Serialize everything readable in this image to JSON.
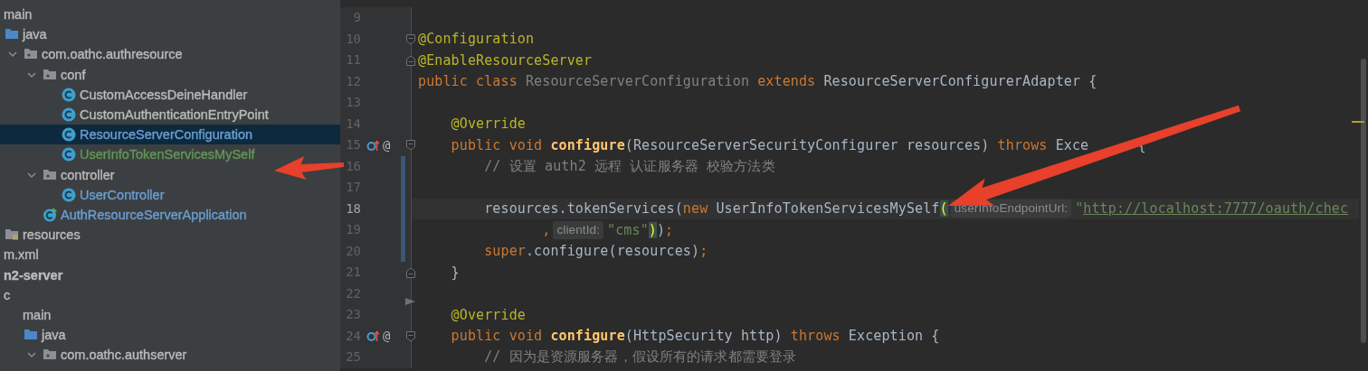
{
  "project_tree": {
    "items": [
      {
        "label": "main",
        "kind": "dir",
        "color": "#bbbbbb",
        "selected": false,
        "children": [
          {
            "label": "java",
            "kind": "source-folder",
            "color": "#bbbbbb",
            "selected": false,
            "children": [
              {
                "label": "com.oathc.authresource",
                "kind": "package",
                "color": "#bbbbbb",
                "selected": false,
                "expanded": true,
                "children": [
                  {
                    "label": "conf",
                    "kind": "package",
                    "color": "#bbbbbb",
                    "selected": false,
                    "expanded": true,
                    "children": [
                      {
                        "label": "CustomAccessDeineHandler",
                        "kind": "class",
                        "color": "#bbbbbb",
                        "selected": false
                      },
                      {
                        "label": "CustomAuthenticationEntryPoint",
                        "kind": "class",
                        "color": "#bbbbbb",
                        "selected": false
                      },
                      {
                        "label": "ResourceServerConfiguration",
                        "kind": "class",
                        "color": "#6a9fd4",
                        "selected": true
                      },
                      {
                        "label": "UserInfoTokenServicesMySelf",
                        "kind": "class",
                        "color": "#629755",
                        "selected": false
                      }
                    ]
                  },
                  {
                    "label": "controller",
                    "kind": "package",
                    "color": "#bbbbbb",
                    "selected": false,
                    "expanded": true,
                    "children": [
                      {
                        "label": "UserController",
                        "kind": "class",
                        "color": "#6a9fd4",
                        "selected": false
                      }
                    ]
                  },
                  {
                    "label": "AuthResourceServerApplication",
                    "kind": "app-class",
                    "color": "#6a9fd4",
                    "selected": false
                  }
                ]
              }
            ]
          },
          {
            "label": "resources",
            "kind": "resources-folder",
            "color": "#bbbbbb",
            "selected": false
          }
        ]
      },
      {
        "label": "m.xml",
        "kind": "file",
        "color": "#bbbbbb",
        "selected": false
      },
      {
        "label": "n2-server",
        "kind": "module",
        "color": "#bbbbbb",
        "selected": false
      },
      {
        "label": "c",
        "kind": "dir",
        "color": "#bbbbbb",
        "selected": false,
        "children": [
          {
            "label": "main",
            "kind": "dir",
            "color": "#bbbbbb",
            "selected": false,
            "children": [
              {
                "label": "java",
                "kind": "source-folder",
                "color": "#bbbbbb",
                "selected": false,
                "children": [
                  {
                    "label": "com.oathc.authserver",
                    "kind": "package",
                    "color": "#bbbbbb",
                    "selected": false,
                    "expanded": true
                  }
                ]
              }
            ]
          }
        ]
      }
    ]
  },
  "editor": {
    "lines": [
      {
        "number": "9"
      },
      {
        "number": "10",
        "fold": {
          "kind": "start"
        },
        "tokens": [
          {
            "kind": "annotation",
            "text": "@Configuration"
          }
        ]
      },
      {
        "number": "11",
        "fold": {
          "kind": "end"
        },
        "tokens": [
          {
            "kind": "annotation",
            "text": "@EnableResourceServer"
          }
        ]
      },
      {
        "number": "12",
        "tokens": [
          {
            "kind": "keyword",
            "text": "public class "
          },
          {
            "kind": "unused",
            "text": "ResourceServerConfiguration"
          },
          {
            "kind": "keyword",
            "text": " extends "
          },
          {
            "kind": "plain",
            "text": "ResourceServerConfigurerAdapter {"
          }
        ]
      },
      {
        "number": "13"
      },
      {
        "number": "14",
        "tokens": [
          {
            "kind": "annotation",
            "text": "    @Override"
          }
        ]
      },
      {
        "number": "15",
        "override": true,
        "gutter_symbol": "@",
        "fold": {
          "kind": "start"
        },
        "tokens": [
          {
            "kind": "keyword",
            "text": "    public void "
          },
          {
            "kind": "method",
            "text": "configure"
          },
          {
            "kind": "plain",
            "text": "(ResourceServerSecurityConfigurer resources) "
          },
          {
            "kind": "keyword",
            "text": "throws"
          },
          {
            "kind": "plain",
            "text": " Exce"
          },
          {
            "kind": "plain",
            "text": "{",
            "covered_before": true
          }
        ]
      },
      {
        "number": "16",
        "changed": true,
        "tokens": [
          {
            "kind": "comment",
            "text": "        // 设置 auth2 远程 认证服务器 校验方法类"
          }
        ]
      },
      {
        "number": "17",
        "changed": true
      },
      {
        "number": "18",
        "current": true,
        "changed": true,
        "tokens": [
          {
            "kind": "plain",
            "text": "        resources.tokenServices("
          },
          {
            "kind": "keyword",
            "text": "new"
          },
          {
            "kind": "plain",
            "text": " UserInfoTokenServicesMySelf"
          },
          {
            "kind": "bracket",
            "text": "("
          },
          {
            "kind": "hint",
            "text": "userInfoEndpointUrl:"
          },
          {
            "kind": "string",
            "text": "\""
          },
          {
            "kind": "link",
            "text": "http://localhost:7777/oauth/chec"
          }
        ]
      },
      {
        "number": "19",
        "changed": true,
        "tokens": [
          {
            "kind": "punct",
            "text": "               ,"
          },
          {
            "kind": "hint",
            "text": "clientId:"
          },
          {
            "kind": "string",
            "text": "\"cms\""
          },
          {
            "kind": "bracket",
            "text": ")"
          },
          {
            "kind": "plain",
            "text": ")"
          },
          {
            "kind": "punct",
            "text": ";"
          }
        ]
      },
      {
        "number": "20",
        "changed": true,
        "tokens": [
          {
            "kind": "keyword",
            "text": "        super"
          },
          {
            "kind": "plain",
            "text": ".configure(resources)"
          },
          {
            "kind": "punct",
            "text": ";"
          }
        ]
      },
      {
        "number": "21",
        "fold": {
          "kind": "end"
        },
        "tokens": [
          {
            "kind": "plain",
            "text": "    }"
          }
        ]
      },
      {
        "number": "22",
        "fold": {
          "kind": "collapsed"
        }
      },
      {
        "number": "23",
        "tokens": [
          {
            "kind": "annotation",
            "text": "    @Override"
          }
        ]
      },
      {
        "number": "24",
        "override": true,
        "gutter_symbol": "@",
        "fold": {
          "kind": "start"
        },
        "tokens": [
          {
            "kind": "keyword",
            "text": "    public void "
          },
          {
            "kind": "method",
            "text": "configure"
          },
          {
            "kind": "plain",
            "text": "(HttpSecurity http) "
          },
          {
            "kind": "keyword",
            "text": "throws"
          },
          {
            "kind": "plain",
            "text": " Exception {"
          }
        ]
      },
      {
        "number": "25",
        "tokens": [
          {
            "kind": "comment",
            "text": "        // 因为是资源服务器，假设所有的请求都需要登录"
          }
        ]
      }
    ]
  }
}
